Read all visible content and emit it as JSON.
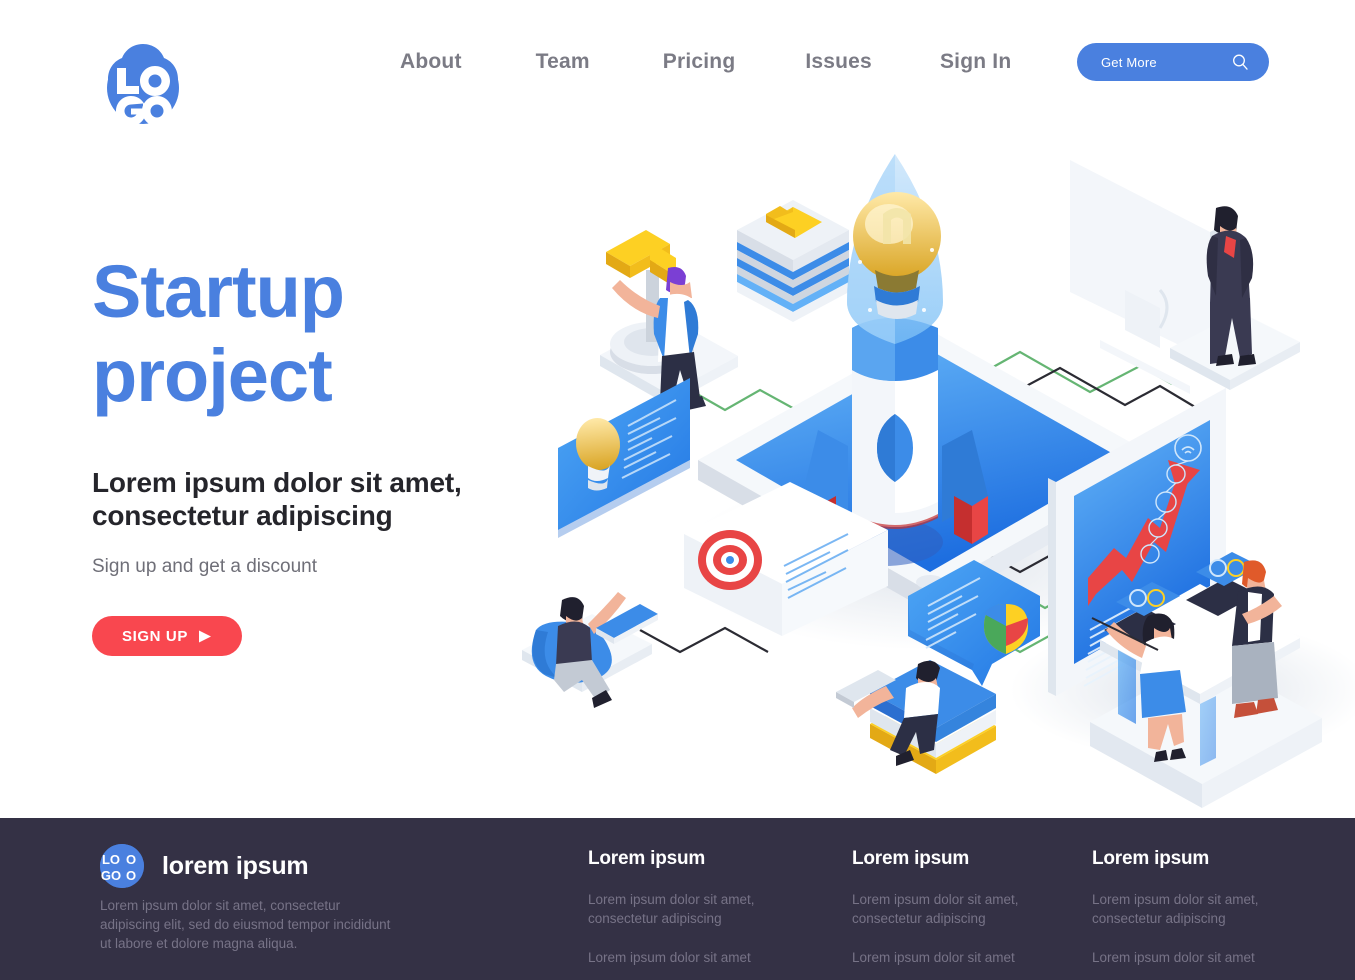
{
  "header": {
    "logo_text_top": "LO",
    "logo_text_bottom": "GO",
    "nav": [
      {
        "label": "About"
      },
      {
        "label": "Team"
      },
      {
        "label": "Pricing"
      },
      {
        "label": "Issues"
      },
      {
        "label": "Sign In"
      }
    ],
    "cta": {
      "label": "Get More",
      "icon": "search-icon"
    },
    "brand_color": "#4a80df"
  },
  "hero": {
    "title_line1": "Startup",
    "title_line2": "project",
    "subtitle_line1": "Lorem ipsum dolor sit amet,",
    "subtitle_line2": "consectetur adipiscing",
    "note": "Sign up and get a discount",
    "cta": {
      "label": "SIGN UP",
      "icon": "play-icon",
      "color": "#f9474f"
    },
    "title_color": "#4a80df"
  },
  "illustration": {
    "name": "isometric-startup-rocket-scene",
    "elements": [
      "rocket-with-lightbulb",
      "tablet-platform",
      "person-turning-lever",
      "server-stack-with-folder",
      "desktop-monitor-with-businessman",
      "lightbulb-info-card",
      "target-info-card",
      "person-in-beanbag-with-laptop",
      "speech-bubble-pie-chart",
      "person-on-books-with-laptop",
      "growth-chart-screen",
      "two-people-at-desk-with-laptops"
    ]
  },
  "footer": {
    "background": "#343145",
    "logo_text_top": "LO",
    "logo_text_bottom": "GO",
    "brand_name": "lorem ipsum",
    "about": "Lorem ipsum dolor sit amet, consectetur adipiscing elit, sed do eiusmod tempor incididunt ut labore et dolore magna aliqua.",
    "columns": [
      {
        "title": "Lorem ipsum",
        "links": [
          "Lorem ipsum dolor sit amet, consectetur adipiscing",
          "Lorem ipsum dolor sit amet"
        ]
      },
      {
        "title": "Lorem ipsum",
        "links": [
          "Lorem ipsum dolor sit amet, consectetur adipiscing",
          "Lorem ipsum dolor sit amet"
        ]
      },
      {
        "title": "Lorem ipsum",
        "links": [
          "Lorem ipsum dolor sit amet, consectetur adipiscing",
          "Lorem ipsum dolor sit amet"
        ]
      }
    ]
  }
}
